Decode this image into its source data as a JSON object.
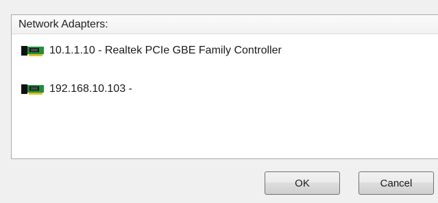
{
  "list": {
    "header": "Network Adapters:",
    "items": [
      {
        "label": "10.1.1.10 - Realtek PCIe GBE Family Controller",
        "icon": "network-card-icon"
      },
      {
        "label": "192.168.10.103 -",
        "icon": "network-card-icon"
      }
    ]
  },
  "buttons": {
    "ok": "OK",
    "cancel": "Cancel"
  },
  "colors": {
    "nic_board": "#1e8f3a",
    "nic_bracket": "#111111",
    "nic_contacts": "#e0c020"
  }
}
